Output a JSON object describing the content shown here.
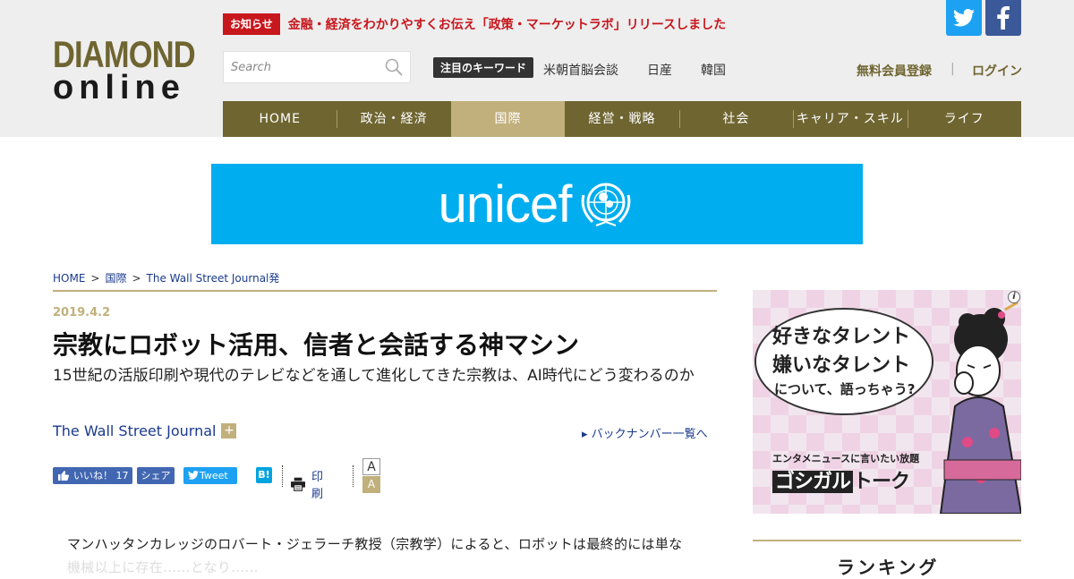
{
  "logo": {
    "line1": "DIAMOND",
    "line2": "online"
  },
  "notice": {
    "tag": "お知らせ",
    "message": "金融・経済をわかりやすくお伝え「政策・マーケットラボ」リリースしました"
  },
  "social": {
    "twitter": "twitter-icon",
    "facebook": "facebook-icon"
  },
  "search": {
    "placeholder": "Search"
  },
  "keywords": {
    "label": "注目のキーワード",
    "items": [
      "米朝首脳会談",
      "日産",
      "韓国"
    ]
  },
  "account": {
    "register": "無料会員登録",
    "separator": "|",
    "login": "ログイン"
  },
  "nav": {
    "items": [
      "HOME",
      "政治・経済",
      "国際",
      "経営・戦略",
      "社会",
      "キャリア・スキル",
      "ライフ"
    ],
    "active": "国際"
  },
  "banner": {
    "text": "unicef",
    "color": "#00aeef"
  },
  "breadcrumb": {
    "items": [
      "HOME",
      "国際",
      "The Wall Street Journal発"
    ],
    "separator": ">"
  },
  "article": {
    "date": "2019.4.2",
    "title": "宗教にロボット活用、信者と会話する神マシン",
    "subtitle": "15世紀の活版印刷や現代のテレビなどを通して進化してきた宗教は、AI時代にどう変わるのか",
    "author": "The Wall Street Journal",
    "author_plus": "+",
    "back_numbers": "▸ バックナンバー一覧へ",
    "body_line1": "マンハッタンカレッジのロバート・ジェラーチ教授（宗教学）によると、ロボットは最終的には単な",
    "body_line2": "機械以上に存在……となり……"
  },
  "share": {
    "like_label": "いいね！",
    "like_count": "17",
    "share_label": "シェア",
    "tweet_label": "Tweet",
    "hatena_label": "B!",
    "print_label": "印刷",
    "font_large": "A",
    "font_small": "A"
  },
  "ad": {
    "line1": "好きなタレント",
    "line2": "嫌いなタレント",
    "line3": "について、語っちゃう?",
    "footer_small": "エンタメニュースに言いたい放題",
    "footer_brand_inverted": "ゴシガル",
    "footer_brand_rest": "トーク",
    "info": "i"
  },
  "ranking": {
    "title": "ランキング"
  },
  "colors": {
    "brand": "#6f6531",
    "accent": "#c1b07c",
    "link": "#1a3a8c",
    "notice": "#c8161d"
  }
}
